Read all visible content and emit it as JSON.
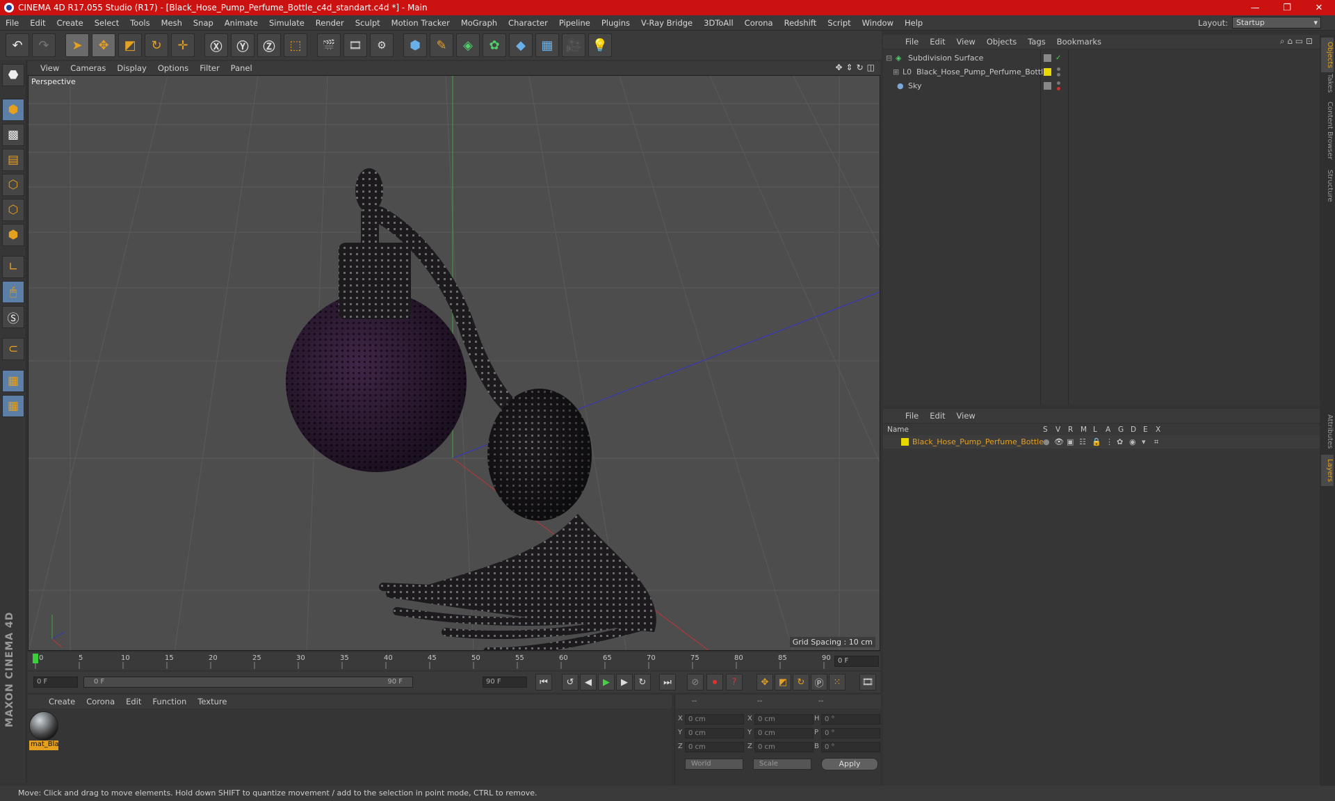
{
  "window": {
    "title": "CINEMA 4D R17.055 Studio (R17) - [Black_Hose_Pump_Perfume_Bottle_c4d_standart.c4d *] - Main",
    "min_glyph": "—",
    "max_glyph": "❐",
    "close_glyph": "✕"
  },
  "menu": [
    "File",
    "Edit",
    "Create",
    "Select",
    "Tools",
    "Mesh",
    "Snap",
    "Animate",
    "Simulate",
    "Render",
    "Sculpt",
    "Motion Tracker",
    "MoGraph",
    "Character",
    "Pipeline",
    "Plugins",
    "V-Ray Bridge",
    "3DToAll",
    "Corona",
    "Redshift",
    "Script",
    "Window",
    "Help"
  ],
  "layout": {
    "label": "Layout:",
    "value": "Startup"
  },
  "viewport": {
    "menu": [
      "View",
      "Cameras",
      "Display",
      "Options",
      "Filter",
      "Panel"
    ],
    "label": "Perspective",
    "grid_spacing": "Grid Spacing : 10 cm"
  },
  "timeline": {
    "ticks": [
      "0",
      "5",
      "10",
      "15",
      "20",
      "25",
      "30",
      "35",
      "40",
      "45",
      "50",
      "55",
      "60",
      "65",
      "70",
      "75",
      "80",
      "85",
      "90"
    ],
    "current_frame": "0 F",
    "start_field": "0 F",
    "range_start": "0 F",
    "range_end": "90 F",
    "end_field": "90 F"
  },
  "material_manager": {
    "menu": [
      "Create",
      "Corona",
      "Edit",
      "Function",
      "Texture"
    ],
    "material_label": "mat_Bla"
  },
  "coordinates": {
    "header": [
      "--",
      "--",
      "--"
    ],
    "rows": [
      {
        "a": "X",
        "v1": "0 cm",
        "b": "X",
        "v2": "0 cm",
        "c": "H",
        "v3": "0 °"
      },
      {
        "a": "Y",
        "v1": "0 cm",
        "b": "Y",
        "v2": "0 cm",
        "c": "P",
        "v3": "0 °"
      },
      {
        "a": "Z",
        "v1": "0 cm",
        "b": "Z",
        "v2": "0 cm",
        "c": "B",
        "v3": "0 °"
      }
    ],
    "mode1": "World",
    "mode2": "Scale",
    "apply": "Apply"
  },
  "status": "Move: Click and drag to move elements. Hold down SHIFT to quantize movement / add to the selection in point mode, CTRL to remove.",
  "object_manager": {
    "menu": [
      "File",
      "Edit",
      "View",
      "Objects",
      "Tags",
      "Bookmarks"
    ],
    "objects": [
      {
        "name": "Subdivision Surface"
      },
      {
        "name": "Black_Hose_Pump_Perfume_Bottle"
      },
      {
        "name": "Sky"
      }
    ]
  },
  "layer_manager": {
    "menu": [
      "File",
      "Edit",
      "View"
    ],
    "columns": [
      "Name",
      "S",
      "V",
      "R",
      "M",
      "L",
      "A",
      "G",
      "D",
      "E",
      "X"
    ],
    "layers": [
      {
        "name": "Black_Hose_Pump_Perfume_Bottle"
      }
    ]
  },
  "right_tabs": [
    "Objects",
    "Takes",
    "Content Browser",
    "Structure",
    "Attributes",
    "Layers"
  ],
  "brand": "MAXON CINEMA 4D",
  "colors": {
    "accent": "#e5a020",
    "title_bar": "#cc1111",
    "layer_yellow": "#e8d800"
  }
}
